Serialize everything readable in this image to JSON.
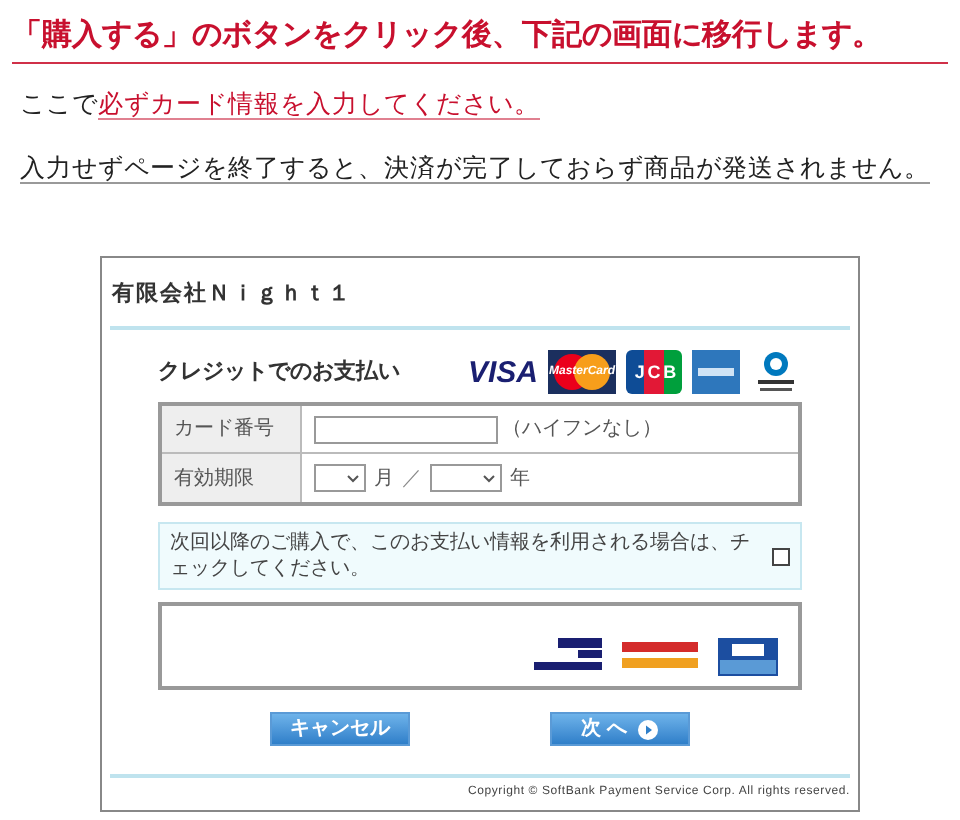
{
  "heading": "「購入する」のボタンをクリック後、下記の画面に移行します。",
  "instruction": {
    "prefix": "ここで",
    "highlight": "必ずカード情報を入力してください。"
  },
  "warning": "入力せずページを終了すると、決済が完了しておらず商品が発送されません。",
  "panel": {
    "title": "有限会社Ｎｉｇｈｔ１",
    "section_title": "クレジットでのお支払い",
    "card_logos": [
      {
        "kind": "visa",
        "text": "VISA"
      },
      {
        "kind": "mastercard",
        "text": "MasterCard"
      },
      {
        "kind": "jcb",
        "text": "JCB"
      },
      {
        "kind": "amex"
      },
      {
        "kind": "diners"
      }
    ],
    "form": {
      "card_number": {
        "label": "カード番号",
        "hint": "（ハイフンなし）"
      },
      "expiry": {
        "label": "有効期限",
        "month_unit": "月",
        "separator": "／",
        "year_unit": "年"
      }
    },
    "save_option": {
      "label": "次回以降のご購入で、このお支払い情報を利用される場合は、チェックしてください。",
      "checked": false
    },
    "secure_badges": [
      {
        "kind": "verified"
      },
      {
        "kind": "securecode"
      },
      {
        "kind": "jsecure"
      }
    ],
    "buttons": [
      {
        "kind": "cancel",
        "label": "キャンセル"
      },
      {
        "kind": "next",
        "label": "次 へ"
      }
    ],
    "copyright": "Copyright © SoftBank Payment Service Corp. All rights reserved."
  }
}
